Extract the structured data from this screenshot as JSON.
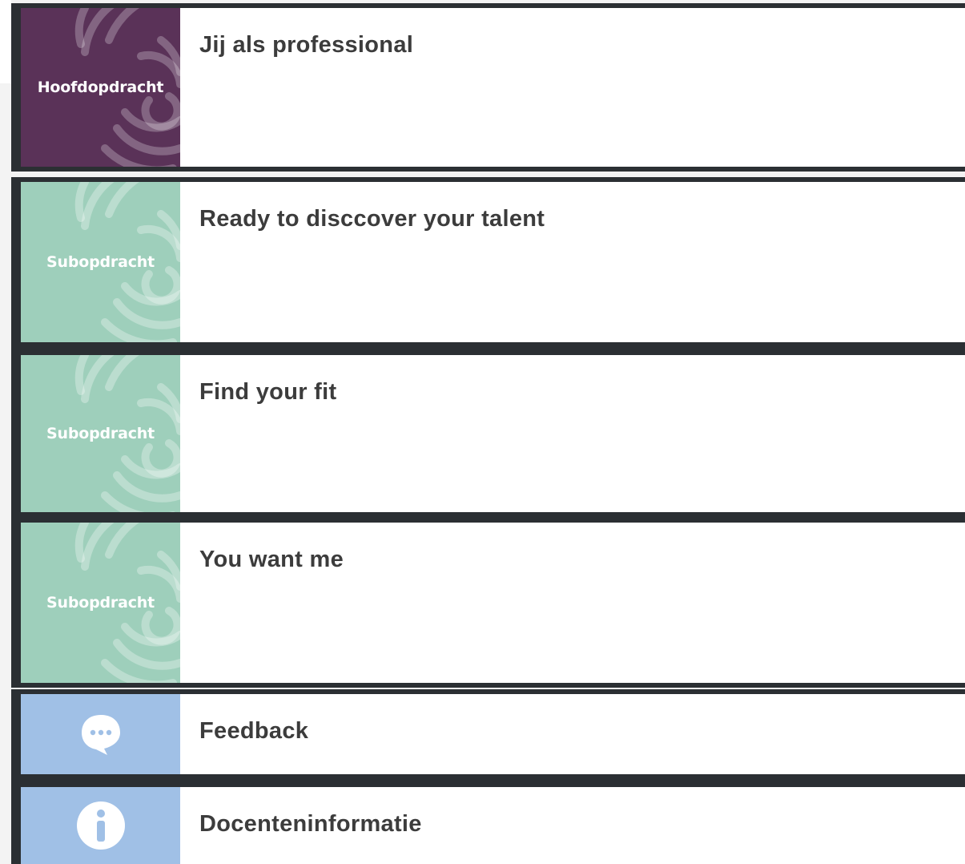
{
  "cards": [
    {
      "tile_label": "Hoofdopdracht",
      "title": "Jij als professional"
    },
    {
      "tile_label": "Subopdracht",
      "title": "Ready to disccover your talent"
    },
    {
      "tile_label": "Subopdracht",
      "title": "Find your fit"
    },
    {
      "tile_label": "Subopdracht",
      "title": "You want me"
    },
    {
      "icon": "speech-bubble-icon",
      "title": "Feedback"
    },
    {
      "icon": "info-icon",
      "title": "Docenteninformatie"
    }
  ],
  "colors": {
    "hoofdopdracht": "#5a3258",
    "subopdracht": "#9ecfbb",
    "info_tile": "#a0c0e6",
    "card_border": "#2b2f33",
    "title_text": "#3c3c3c"
  }
}
